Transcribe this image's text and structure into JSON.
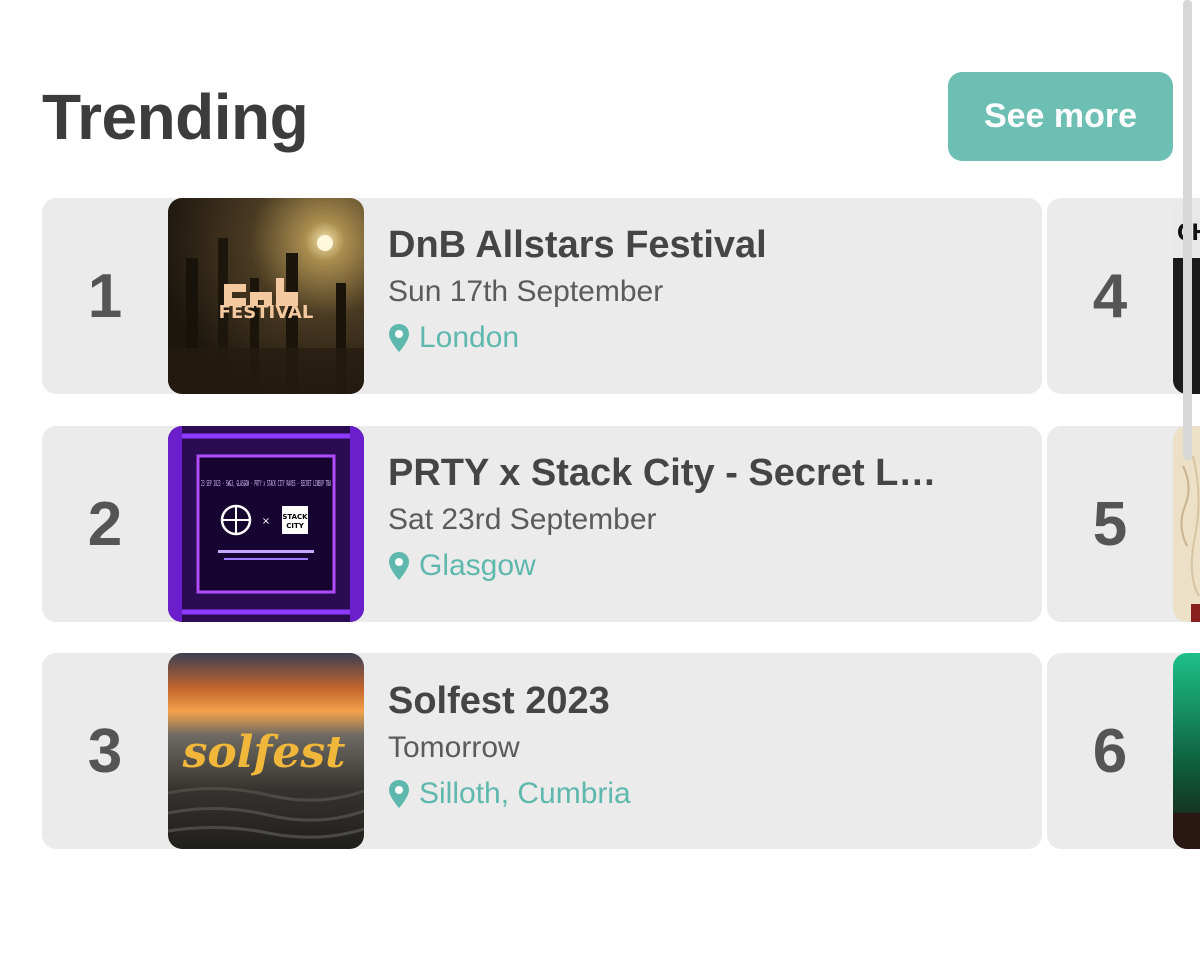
{
  "header": {
    "title": "Trending",
    "see_more_label": "See more"
  },
  "events": [
    {
      "rank": "1",
      "name": "DnB Allstars Festival",
      "date": "Sun 17th September",
      "location": "London",
      "thumb_text": "FESTIVAL"
    },
    {
      "rank": "2",
      "name": "PRTY x Stack City - Secret L…",
      "date": "Sat 23rd September",
      "location": "Glasgow",
      "thumb_text": "23 SEP 2023 · SWG3, GLASGOW · PRTY x STACK CITY RAVES · SECRET LINEUP TBA"
    },
    {
      "rank": "3",
      "name": "Solfest 2023",
      "date": "Tomorrow",
      "location": "Silloth, Cumbria",
      "thumb_text": "solfest"
    }
  ],
  "side_cards": [
    {
      "rank": "4",
      "thumb_text": "CH"
    },
    {
      "rank": "5"
    },
    {
      "rank": "6"
    }
  ],
  "colors": {
    "accent": "#6dbfb4",
    "location": "#5fb8ad",
    "card_bg": "#ebebeb",
    "title": "#3c3c3c"
  },
  "icons": {
    "location": "location-pin-icon"
  }
}
